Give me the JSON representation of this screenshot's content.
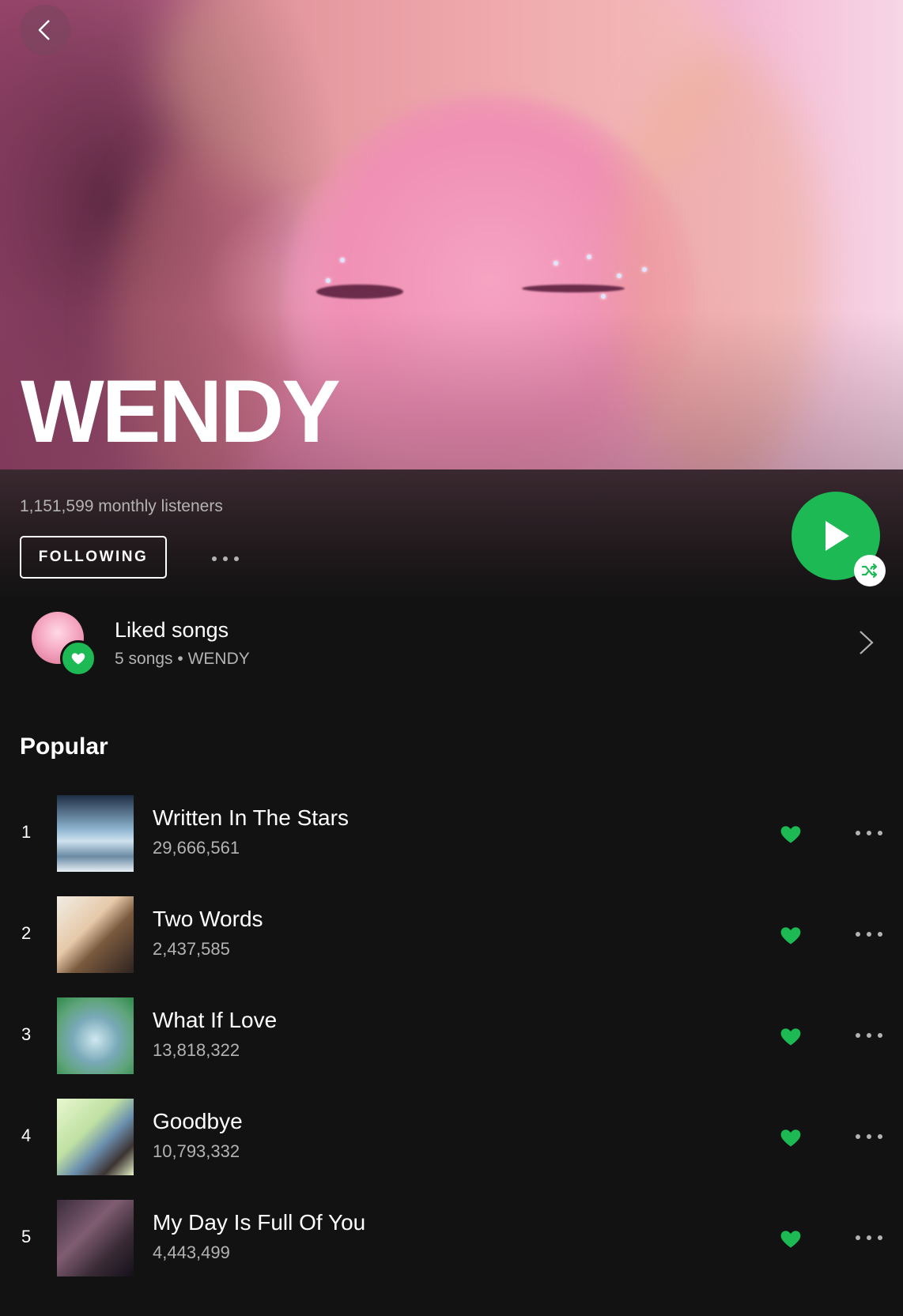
{
  "artist": {
    "name": "WENDY",
    "monthly_listeners": "1,151,599 monthly listeners",
    "follow_label": "FOLLOWING"
  },
  "liked": {
    "title": "Liked songs",
    "subtitle": "5 songs • WENDY"
  },
  "popular": {
    "title": "Popular",
    "tracks": [
      {
        "num": "1",
        "title": "Written In The Stars",
        "plays": "29,666,561"
      },
      {
        "num": "2",
        "title": "Two Words",
        "plays": "2,437,585"
      },
      {
        "num": "3",
        "title": "What If Love",
        "plays": "13,818,322"
      },
      {
        "num": "4",
        "title": "Goodbye",
        "plays": "10,793,332"
      },
      {
        "num": "5",
        "title": "My Day Is Full Of You",
        "plays": "4,443,499"
      }
    ]
  },
  "colors": {
    "accent": "#1db954",
    "background": "#121212",
    "secondary_text": "#b3b3b3"
  },
  "icons": [
    "back-icon",
    "more-icon",
    "play-icon",
    "shuffle-icon",
    "heart-icon",
    "chevron-right-icon"
  ]
}
